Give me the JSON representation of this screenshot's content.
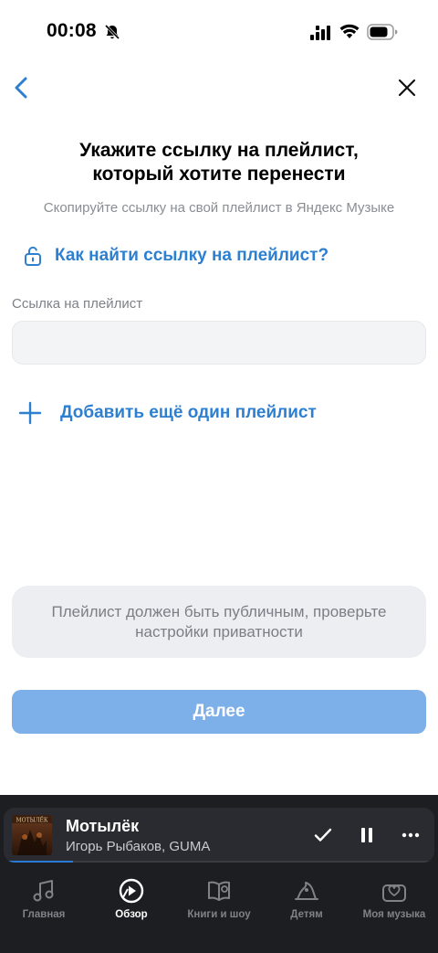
{
  "status_bar": {
    "time": "00:08"
  },
  "header": {
    "title_line1": "Укажите ссылку на плейлист,",
    "title_line2": "который хотите перенести",
    "subtitle": "Скопируйте ссылку на свой плейлист в Яндекс Музыке"
  },
  "help_link": {
    "label": "Как найти ссылку на плейлист?"
  },
  "playlist_field": {
    "label": "Ссылка на плейлист",
    "value": "",
    "placeholder": ""
  },
  "add_playlist": {
    "label": "Добавить ещё один плейлист"
  },
  "notice": {
    "text": "Плейлист должен быть публичным, проверьте настройки приватности"
  },
  "next_button": {
    "label": "Далее"
  },
  "mini_player": {
    "cover_text": "МОТЫЛЁК",
    "title": "Мотылёк",
    "artist": "Игорь Рыбаков, GUMA",
    "progress": 0.16
  },
  "tabs": [
    {
      "label": "Главная",
      "icon": "music-note-icon",
      "active": false
    },
    {
      "label": "Обзор",
      "icon": "compass-play-icon",
      "active": true
    },
    {
      "label": "Книги и шоу",
      "icon": "book-mic-icon",
      "active": false
    },
    {
      "label": "Детям",
      "icon": "kids-hat-icon",
      "active": false
    },
    {
      "label": "Моя музыка",
      "icon": "heart-folder-icon",
      "active": false
    }
  ],
  "colors": {
    "accent": "#2d7fd0",
    "button_disabled": "#7dafe9",
    "dock": "#1d1e22"
  }
}
